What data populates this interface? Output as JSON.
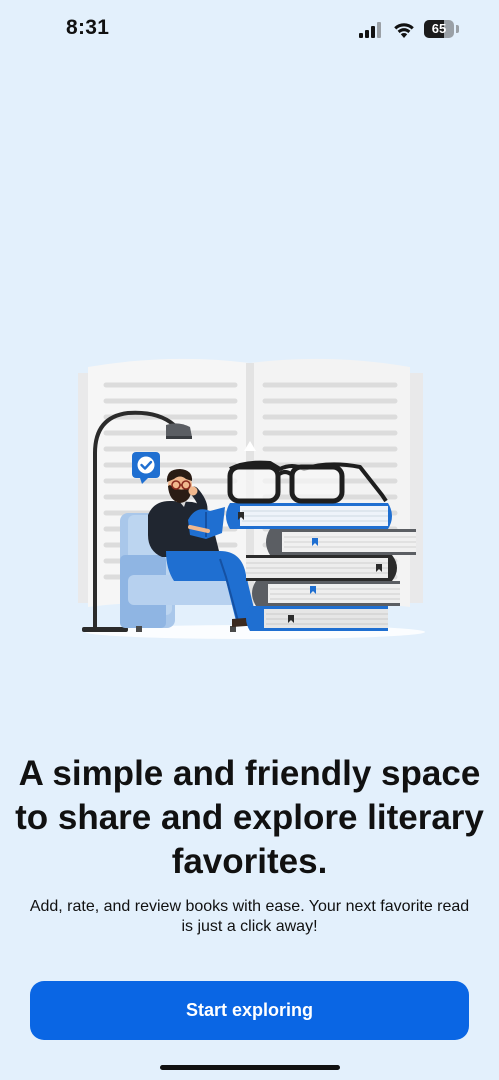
{
  "status_bar": {
    "time": "8:31",
    "battery_level": "65",
    "icons": [
      "cellular-signal-icon",
      "wifi-icon",
      "battery-icon"
    ]
  },
  "onboarding": {
    "illustration": "person-reading-with-books-illustration",
    "headline": "A simple and friendly space to share and explore literary favorites.",
    "subtext": "Add, rate, and review books with ease. Your next favorite read is just a click away!",
    "cta_label": "Start exploring"
  },
  "colors": {
    "background": "#e3f0fc",
    "primary_button": "#0a66e4",
    "illustration_blue": "#1f6fd1",
    "text": "#111111"
  }
}
